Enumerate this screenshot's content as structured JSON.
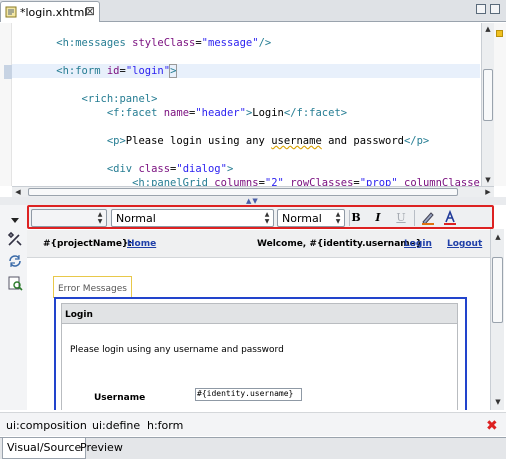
{
  "tab": {
    "title": "*login.xhtml",
    "close": "⊠"
  },
  "code": [
    {
      "indent": "    ",
      "parts": [
        {
          "c": "t-tag",
          "t": "<h:messages "
        },
        {
          "c": "t-attr",
          "t": "styleClass"
        },
        {
          "c": "t-txt",
          "t": "="
        },
        {
          "c": "t-str",
          "t": "\"message\""
        },
        {
          "c": "t-tag",
          "t": "/>"
        }
      ]
    },
    {
      "indent": "",
      "parts": []
    },
    {
      "indent": "    ",
      "cur": true,
      "parts": [
        {
          "c": "t-tag",
          "t": "<h:form "
        },
        {
          "c": "t-attr",
          "t": "id"
        },
        {
          "c": "t-txt",
          "t": "="
        },
        {
          "c": "t-str",
          "t": "\"login\""
        },
        {
          "c": "t-tag bracket-box",
          "t": ">"
        }
      ]
    },
    {
      "indent": "",
      "parts": []
    },
    {
      "indent": "        ",
      "parts": [
        {
          "c": "t-tag",
          "t": "<rich:panel>"
        }
      ]
    },
    {
      "indent": "            ",
      "parts": [
        {
          "c": "t-tag",
          "t": "<f:facet "
        },
        {
          "c": "t-attr",
          "t": "name"
        },
        {
          "c": "t-txt",
          "t": "="
        },
        {
          "c": "t-str",
          "t": "\"header\""
        },
        {
          "c": "t-tag",
          "t": ">"
        },
        {
          "c": "t-txt",
          "t": "Login"
        },
        {
          "c": "t-tag",
          "t": "</f:facet>"
        }
      ]
    },
    {
      "indent": "",
      "parts": []
    },
    {
      "indent": "            ",
      "parts": [
        {
          "c": "t-tag",
          "t": "<p>"
        },
        {
          "c": "t-txt",
          "t": "Please login using any "
        },
        {
          "c": "t-txt t-ul",
          "t": "username"
        },
        {
          "c": "t-txt",
          "t": " and password"
        },
        {
          "c": "t-tag",
          "t": "</p>"
        }
      ]
    },
    {
      "indent": "",
      "parts": []
    },
    {
      "indent": "            ",
      "parts": [
        {
          "c": "t-tag",
          "t": "<div "
        },
        {
          "c": "t-attr",
          "t": "class"
        },
        {
          "c": "t-txt",
          "t": "="
        },
        {
          "c": "t-str",
          "t": "\"dialog\""
        },
        {
          "c": "t-tag",
          "t": ">"
        }
      ]
    },
    {
      "indent": "                ",
      "parts": [
        {
          "c": "t-tag",
          "t": "<h:panelGrid "
        },
        {
          "c": "t-attr",
          "t": "columns"
        },
        {
          "c": "t-txt",
          "t": "="
        },
        {
          "c": "t-str",
          "t": "\"2\""
        },
        {
          "c": "t-txt",
          "t": " "
        },
        {
          "c": "t-attr",
          "t": "rowClasses"
        },
        {
          "c": "t-txt",
          "t": "="
        },
        {
          "c": "t-str",
          "t": "\"prop\""
        },
        {
          "c": "t-txt",
          "t": " "
        },
        {
          "c": "t-attr",
          "t": "columnClasses"
        }
      ]
    }
  ],
  "toolbar": {
    "font_select": "",
    "style_select": "Normal",
    "size_select": "Normal",
    "bold": "B",
    "italic": "I",
    "underline": "U"
  },
  "preview": {
    "project": "#{projectName}:",
    "home": "Home",
    "welcome": "Welcome, #{identity.username}",
    "login_link": "Login",
    "logout": "Logout",
    "error_messages": "Error Messages",
    "panel_header": "Login",
    "instruction": "Please login using any username and password",
    "username_label": "Username",
    "username_value": "#{identity.username}"
  },
  "breadcrumbs": [
    "ui:composition",
    "ui:define",
    "h:form"
  ],
  "bottom_tabs": [
    "Visual/Source",
    "Preview"
  ],
  "colors": {
    "toolbar_highlight": "#dd2222",
    "preview_outline": "#2244cc",
    "link": "#1f3fa8"
  }
}
